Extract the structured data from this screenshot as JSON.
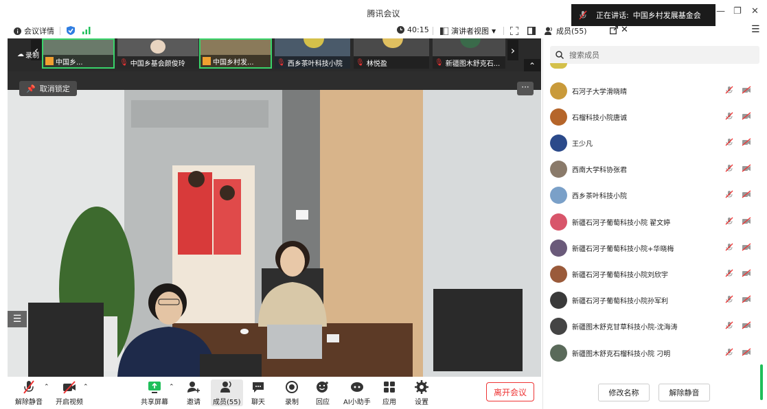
{
  "window": {
    "title": "腾讯会议",
    "speaking_label": "正在讲话:",
    "speaking_name": "中国乡村发展基金会"
  },
  "meeting_bar": {
    "details_label": "会议详情",
    "timer": "40:15",
    "view_label": "演讲者视图",
    "members_label": "成员(55)"
  },
  "thumbnails": [
    {
      "label": "中国乡...",
      "active": true
    },
    {
      "label": "中国乡基会颜俊玲",
      "active": false
    },
    {
      "label": "中国乡村发...",
      "active": true
    },
    {
      "label": "西乡茶叶科技小院",
      "active": false
    },
    {
      "label": "林悦盈",
      "active": false
    },
    {
      "label": "新疆图木舒克石...",
      "active": false
    }
  ],
  "video": {
    "recording_label": "录制",
    "unlock_label": "取消锁定",
    "more_label": "···"
  },
  "toolbar": {
    "unmute": "解除静音",
    "start_video": "开启视频",
    "share": "共享屏幕",
    "invite": "邀请",
    "members": "成员(55)",
    "chat": "聊天",
    "record": "录制",
    "reactions": "回应",
    "ai": "AI小助手",
    "apps": "应用",
    "settings": "设置",
    "leave": "离开会议"
  },
  "panel": {
    "search_placeholder": "搜索成员",
    "members": [
      {
        "name": "石河子大学滑晓晴",
        "color": "#c99a3a"
      },
      {
        "name": "石榴科技小院唐诚",
        "color": "#b5652a"
      },
      {
        "name": "王少凡",
        "color": "#2b4a8a"
      },
      {
        "name": "西南大学科协张君",
        "color": "#8a7a6a"
      },
      {
        "name": "西乡茶叶科技小院",
        "color": "#7aa0c8"
      },
      {
        "name": "新疆石河子葡萄科技小院 翟文婷",
        "color": "#d8556a"
      },
      {
        "name": "新疆石河子葡萄科技小院+华晓梅",
        "color": "#6a5a7a"
      },
      {
        "name": "新疆石河子葡萄科技小院刘欣宇",
        "color": "#9a5a3a"
      },
      {
        "name": "新疆石河子葡萄科技小院孙军利",
        "color": "#3a3a3a"
      },
      {
        "name": "新疆图木舒克甘草科技小院-沈海涛",
        "color": "#444"
      },
      {
        "name": "新疆图木舒克石榴科技小院 刁明",
        "color": "#5a6a5a"
      }
    ],
    "rename_label": "修改名称",
    "unmute_label": "解除静音"
  }
}
